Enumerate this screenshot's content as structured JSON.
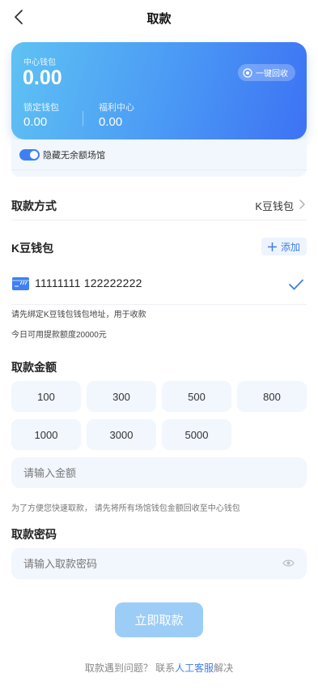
{
  "header": {
    "title": "取款"
  },
  "wallet": {
    "center_label": "中心钱包",
    "center_amount": "0.00",
    "recycle_label": "一键回收",
    "locked_label": "锁定钱包",
    "locked_amount": "0.00",
    "welfare_label": "福利中心",
    "welfare_amount": "0.00"
  },
  "toggle": {
    "label": "隐藏无余额场馆",
    "on": true
  },
  "method": {
    "label": "取款方式",
    "value": "K豆钱包"
  },
  "kdou": {
    "title": "K豆钱包",
    "add_label": "添加",
    "account": "11111111 122222222",
    "selected": true
  },
  "hints": {
    "bind": "请先绑定K豆钱包钱包地址，用于收款",
    "limit": "今日可用提款额度20000元"
  },
  "amount": {
    "title": "取款金额",
    "presets": [
      "100",
      "300",
      "500",
      "800",
      "1000",
      "3000",
      "5000"
    ],
    "placeholder": "请输入金额",
    "note": "为了方便您快速取款， 请先将所有场馆钱包金额回收至中心钱包"
  },
  "password": {
    "title": "取款密码",
    "placeholder": "请输入取款密码"
  },
  "submit_label": "立即取款",
  "help": {
    "prefix": "取款遇到问题？ 联系",
    "link": "人工客服",
    "suffix": "解决"
  },
  "colors": {
    "accent": "#3e7ee8",
    "card_start": "#5fc2f3",
    "card_end": "#3d72f4",
    "submit": "#9ccdf6",
    "field_bg": "#f2f6fd"
  }
}
